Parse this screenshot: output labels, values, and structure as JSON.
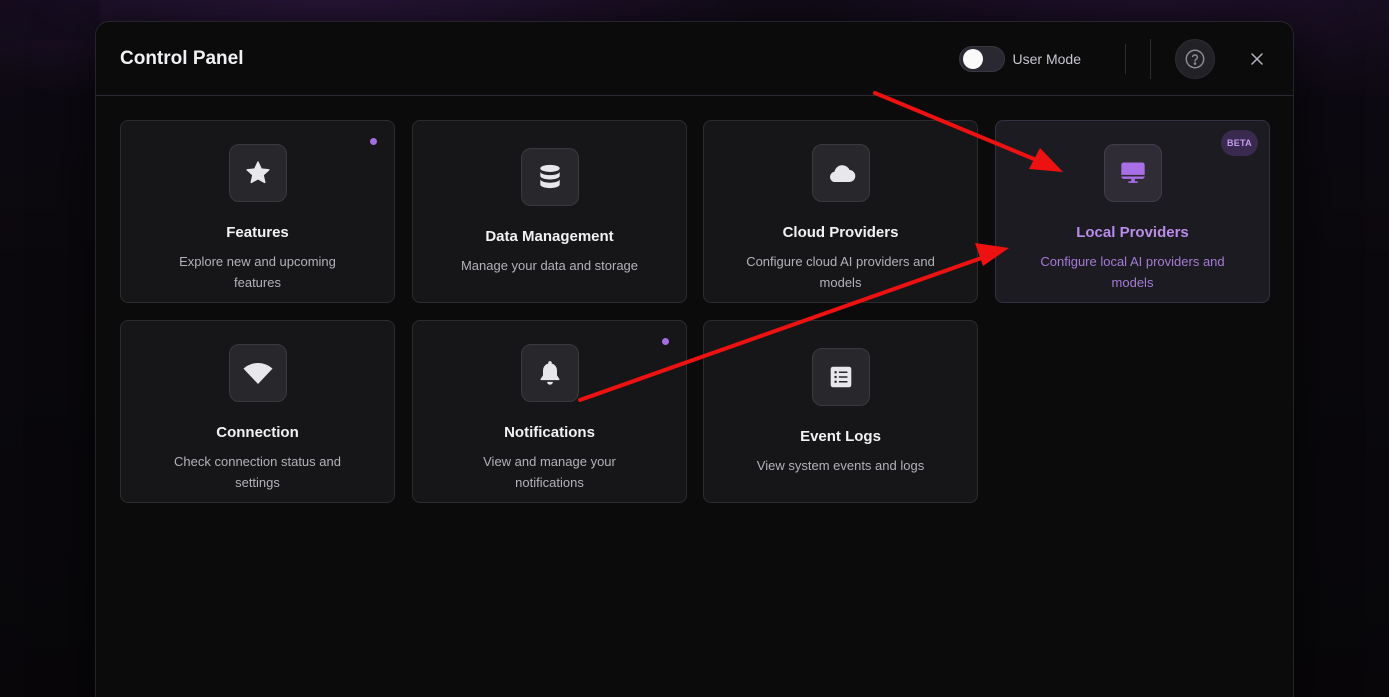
{
  "header": {
    "title": "Control Panel",
    "user_mode_label": "User Mode",
    "user_mode_on": false
  },
  "cards": [
    {
      "id": "features",
      "title": "Features",
      "description": "Explore new and upcoming features",
      "icon": "star-icon",
      "dot": true
    },
    {
      "id": "data-management",
      "title": "Data Management",
      "description": "Manage your data and storage",
      "icon": "database-icon",
      "dot": false
    },
    {
      "id": "cloud-providers",
      "title": "Cloud Providers",
      "description": "Configure cloud AI providers and models",
      "icon": "cloud-icon",
      "dot": false
    },
    {
      "id": "local-providers",
      "title": "Local Providers",
      "description": "Configure local AI providers and models",
      "icon": "monitor-icon",
      "badge": "BETA",
      "selected": true
    },
    {
      "id": "connection",
      "title": "Connection",
      "description": "Check connection status and settings",
      "icon": "wifi-icon",
      "dot": false
    },
    {
      "id": "notifications",
      "title": "Notifications",
      "description": "View and manage your notifications",
      "icon": "bell-icon",
      "dot": true
    },
    {
      "id": "event-logs",
      "title": "Event Logs",
      "description": "View system events and logs",
      "icon": "list-icon",
      "dot": false
    }
  ],
  "colors": {
    "accent": "#a56ee0",
    "annotation_arrow": "#ee1111"
  }
}
